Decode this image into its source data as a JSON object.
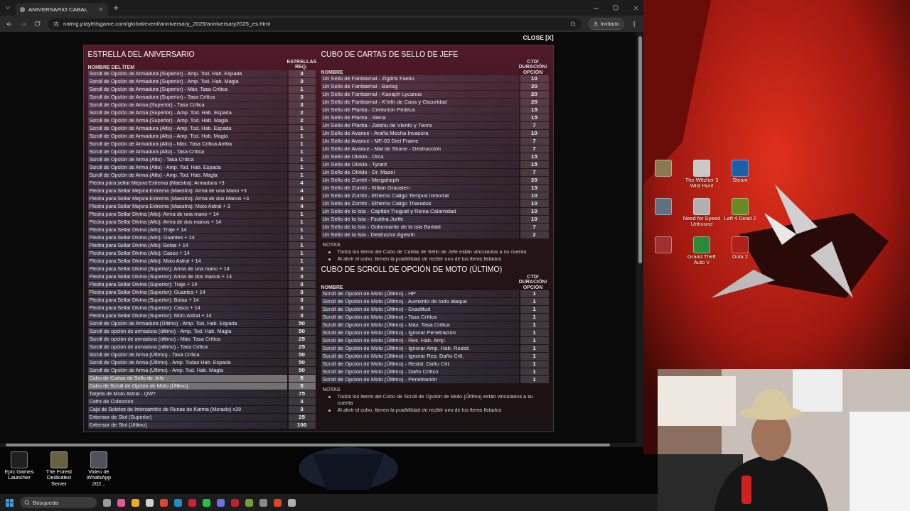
{
  "browser": {
    "tab_title": "ANIVERSARIO CABAL",
    "url": "naimg.playthisgame.com/global/event/anniversary_2025/anniversary2025_es.html",
    "profile": "Invitado"
  },
  "modal": {
    "close": "CLOSE [X]",
    "left": {
      "title": "ESTRELLA DEL ANIVERSARIO",
      "name_header": "NOMBRE DEL ÍTEM",
      "value_header": "ESTRELLAS REQ.",
      "rows": [
        {
          "name": "Scroll de Opción de Armadura (Superior) - Amp. Tod. Hab. Espada",
          "value": "3",
          "highlighted": false
        },
        {
          "name": "Scroll de Opción de Armadura (Superior) - Amp. Tod. Hab. Magia",
          "value": "3",
          "highlighted": false
        },
        {
          "name": "Scroll de Opción de Armadura (Superior) - Máx. Tasa Crítica",
          "value": "1",
          "highlighted": false
        },
        {
          "name": "Scroll de Opción de Armadura (Superior) - Tasa Crítica",
          "value": "3",
          "highlighted": false
        },
        {
          "name": "Scroll de Opción de Arma (Superior) - Tasa Crítica",
          "value": "3",
          "highlighted": false
        },
        {
          "name": "Scroll de Opción de Arma (Superior) - Amp. Tod. Hab. Espada",
          "value": "2",
          "highlighted": false
        },
        {
          "name": "Scroll de Opción de Arma (Superior) - Amp. Tod. Hab. Magia",
          "value": "2",
          "highlighted": false
        },
        {
          "name": "Scroll de Opción de Armadura (Alto) - Amp. Tod. Hab. Espada",
          "value": "1",
          "highlighted": false
        },
        {
          "name": "Scroll de Opción de Armadura (Alto) - Amp. Tod. Hab. Magia",
          "value": "1",
          "highlighted": false
        },
        {
          "name": "Scroll de Opción de Armadura (Alto) - Máx. Tasa Crítica Arriba",
          "value": "1",
          "highlighted": false
        },
        {
          "name": "Scroll de Opción de Armadura (Alto) - Tasa Crítica",
          "value": "1",
          "highlighted": false
        },
        {
          "name": "Scroll de Opción de Arma (Alto) - Tasa Crítica",
          "value": "1",
          "highlighted": false
        },
        {
          "name": "Scroll de Opción de Arma (Alto) - Amp. Tod. Hab. Espada",
          "value": "1",
          "highlighted": false
        },
        {
          "name": "Scroll de Opción de Arma (Alto) - Amp. Tod. Hab. Magia",
          "value": "1",
          "highlighted": false
        },
        {
          "name": "Piedra para sellar Mejora Extrema (Maestra): Armadura +3",
          "value": "4",
          "highlighted": false
        },
        {
          "name": "Piedra para Sellar Mejora Extrema (Maestra): Arma de una Mano +3",
          "value": "4",
          "highlighted": false
        },
        {
          "name": "Piedra para Sellar Mejora Extrema (Maestra): Arma de dos Manos +3",
          "value": "4",
          "highlighted": false
        },
        {
          "name": "Piedra para Sellar Mejora Extrema (Maestra): Moto Astral + 3",
          "value": "4",
          "highlighted": false
        },
        {
          "name": "Piedra para Sellar Divina (Alto): Arma de una mano + 14",
          "value": "1",
          "highlighted": false
        },
        {
          "name": "Piedra para Sellar Divina (Alto): Arma de dos manos + 14",
          "value": "1",
          "highlighted": false
        },
        {
          "name": "Piedra para Sellar Divina (Alto): Traje + 14",
          "value": "1",
          "highlighted": false
        },
        {
          "name": "Piedra para Sellar Divina (Alto): Guantes + 14",
          "value": "1",
          "highlighted": false
        },
        {
          "name": "Piedra para Sellar Divina (Alto): Botas + 14",
          "value": "1",
          "highlighted": false
        },
        {
          "name": "Piedra para Sellar Divina (Alto): Casco + 14",
          "value": "1",
          "highlighted": false
        },
        {
          "name": "Piedra para Sellar Divina (Alto): Moto Astral + 14",
          "value": "1",
          "highlighted": false
        },
        {
          "name": "Piedra para Sellar Divina (Superior): Arma de una mano + 14",
          "value": "3",
          "highlighted": false
        },
        {
          "name": "Piedra para Sellar Divina (Superior): Arma de dos manos + 14",
          "value": "3",
          "highlighted": false
        },
        {
          "name": "Piedra para Sellar Divina (Superior): Traje + 14",
          "value": "3",
          "highlighted": false
        },
        {
          "name": "Piedra para Sellar Divina (Superior): Guantes + 14",
          "value": "3",
          "highlighted": false
        },
        {
          "name": "Piedra para Sellar Divina (Superior): Botas + 14",
          "value": "3",
          "highlighted": false
        },
        {
          "name": "Piedra para Sellar Divina (Superior): Casco + 14",
          "value": "3",
          "highlighted": false
        },
        {
          "name": "Piedra para Sellar Divina (Superior): Moto Astral + 14",
          "value": "3",
          "highlighted": false
        },
        {
          "name": "Scroll de Opción de Armadura (Último) - Amp. Tod. Hab. Espada",
          "value": "50",
          "highlighted": false
        },
        {
          "name": "Scroll de opción de armadura (último) - Amp. Tod. Hab. Magia",
          "value": "50",
          "highlighted": false
        },
        {
          "name": "Scroll de opción de armadura (último) - Máx. Tasa Crítica",
          "value": "25",
          "highlighted": false
        },
        {
          "name": "Scroll de opción de armadura (último) - Tasa Crítica",
          "value": "25",
          "highlighted": false
        },
        {
          "name": "Scroll de Opción de Arma (Último) - Tasa Crítica",
          "value": "50",
          "highlighted": false
        },
        {
          "name": "Scroll de Opción de Arma (Último) - Amp. Todas Hab. Espada",
          "value": "50",
          "highlighted": false
        },
        {
          "name": "Scroll de Opción de Arma (Último) - Amp. Tod. Hab. Magia",
          "value": "50",
          "highlighted": false
        },
        {
          "name": "Cubo de Cartas de Sello de Jefe",
          "value": "5",
          "highlighted": true
        },
        {
          "name": "Cubo de Scroll de Opción de Moto (Último)",
          "value": "5",
          "highlighted": true
        },
        {
          "name": "Tarjeta de Moto Astral - QW7",
          "value": "75",
          "highlighted": false
        },
        {
          "name": "Cofre de Colección",
          "value": "3",
          "highlighted": false
        },
        {
          "name": "Caja de Boletos de intercambio de Runas de Karma (Morado) x20",
          "value": "3",
          "highlighted": false
        },
        {
          "name": "Extensor de Slot (Superior)",
          "value": "25",
          "highlighted": false
        },
        {
          "name": "Extensor de Slot (Último)",
          "value": "100",
          "highlighted": false
        }
      ]
    },
    "right": [
      {
        "title": "CUBO DE CARTAS DE SELLO DE JEFE",
        "name_header": "NOMBRE",
        "value_header": "CTD/DURACIÓN/OPCIÓN",
        "rows": [
          {
            "name": "Un Sello de Fantasmal - Zigdris Faello",
            "value": "10"
          },
          {
            "name": "Un Sello de Fantasmal - Barlog",
            "value": "20"
          },
          {
            "name": "Un Sello de Fantasmal - Kanaph Lycanus",
            "value": "20"
          },
          {
            "name": "Un Sello de Fantasmal - K'nith de Caos y Oscuridad",
            "value": "20"
          },
          {
            "name": "Un Sello de Planta - Centurion Prideus",
            "value": "15"
          },
          {
            "name": "Un Sello de Planta - Siena",
            "value": "15"
          },
          {
            "name": "Un Sello de Planta -  Zaishu de Viento y Tierra",
            "value": "7"
          },
          {
            "name": "Un Sello de Avance - Araña Mecha Invasora",
            "value": "10"
          },
          {
            "name": "Un Sello de Avance - MF-03 Drei Frame",
            "value": "7"
          },
          {
            "name": "Un Sello de Avance - Mal de Shane - Destrucción",
            "value": "7"
          },
          {
            "name": "Un Sello de Olvido - Orca",
            "value": "15"
          },
          {
            "name": "Un Sello de Olvido - Tyrant",
            "value": "15"
          },
          {
            "name": "Un Sello de Olvido - Dr. Mazel",
            "value": "7"
          },
          {
            "name": "Un Sello de Zombi - Mergaheph",
            "value": "20"
          },
          {
            "name": "Un Sello de Zombi - Killian Grausten",
            "value": "15"
          },
          {
            "name": "Un Sello de Zombi - Etherno Caligo Tempus Inmortal",
            "value": "10"
          },
          {
            "name": "Un Sello de Zombi - Etherno Caligo Thanatos",
            "value": "10"
          },
          {
            "name": "Un Sello de la Isla - Capitán Trugust y Reina Calamidad",
            "value": "10"
          },
          {
            "name": "Un Sello de la Isla - Fsobha Jurife",
            "value": "10"
          },
          {
            "name": "Un Sello de la Isla - Gobernante de la Isla Bariald",
            "value": "7"
          },
          {
            "name": "Un Sello de la Isla - Destructor Ageluth",
            "value": "2"
          }
        ],
        "notes_title": "NOTAS",
        "notes": [
          "Todos los items del Cubo de Cartas de Sello de Jefe están vinculados a su cuenta",
          "Al abrir el cubo, tienen la posibilidad de recibir uno de los items listados"
        ]
      },
      {
        "title": "CUBO DE SCROLL DE OPCIÓN DE MOTO (ÚLTIMO)",
        "name_header": "NOMBRE",
        "value_header": "CTD/DURACIÓN/OPCIÓN",
        "rows": [
          {
            "name": "Scroll de Opción de Moto (Último) - HP",
            "value": "1"
          },
          {
            "name": "Scroll de Opción de Moto (Último) - Aumento de todo ataque",
            "value": "1"
          },
          {
            "name": "Scroll de Opción de Moto (Último) - Exactitud",
            "value": "1"
          },
          {
            "name": "Scroll de Opción de Moto (Último) - Tasa Crítica",
            "value": "1"
          },
          {
            "name": "Scroll de Opción de Moto (Último) - Máx. Tasa Crítica",
            "value": "1"
          },
          {
            "name": "Scroll de Opción de Moto (Último) - Ignorar Penetración",
            "value": "1"
          },
          {
            "name": "Scroll de Opción de Moto (Último) - Res. Hab. Amp.",
            "value": "1"
          },
          {
            "name": "Scroll de Opción de Moto (Último) - Ignorar Amp. Hab. Resist.",
            "value": "1"
          },
          {
            "name": "Scroll de Opción de Moto (Último) - Ignorar Res. Daño Crit.",
            "value": "1"
          },
          {
            "name": "Scroll de Opción de Moto (Último) - Resist. Daño Crit.",
            "value": "1"
          },
          {
            "name": "Scroll de Opción de Moto (Último) - Daño Crítico",
            "value": "1"
          },
          {
            "name": "Scroll de Opción de Moto (Último) - Penetración",
            "value": "1"
          }
        ],
        "notes_title": "NOTAS",
        "notes": [
          "Todos los items del Cubo de Scroll de Opción de Moto (Último) están vinculados a su cuenta",
          "Al abrir el cubo, tienen la posibilidad de recibir uno de los items listados"
        ]
      }
    ]
  },
  "desktop": {
    "right_icons": [
      {
        "color": "#8a7a50"
      },
      {
        "label": "The Witcher 3 Wild Hunt",
        "color": "#c8c8c8"
      },
      {
        "label": "Steam",
        "color": "#1b5fa8"
      },
      {
        "color": "#607080"
      },
      {
        "label": "Need for Speed Unbound",
        "color": "#b0b0b0"
      },
      {
        "label": "Left 4 Dead 2",
        "color": "#6a8a20"
      },
      {
        "color": "#a03030"
      },
      {
        "label": "Grand Theft Auto V",
        "color": "#2a8a3a"
      },
      {
        "label": "Dota 2",
        "color": "#b02018"
      }
    ],
    "left_icons": [
      {
        "label": "Epic Games Launcher",
        "color": "#202020"
      },
      {
        "label": "The Forest Dedicated Server",
        "color": "#6a6040"
      },
      {
        "label": "Video de WhatsApp 202...",
        "color": "#505060"
      }
    ]
  },
  "taskbar": {
    "search": {
      "placeholder": "Búsqueda"
    },
    "apps": [
      {
        "color": "#9a9a9a"
      },
      {
        "color": "#e05a9a"
      },
      {
        "color": "#e8b020"
      },
      {
        "color": "#d0d0d0"
      },
      {
        "color": "#e0442a"
      },
      {
        "color": "#1e90c8"
      },
      {
        "color": "#d02030"
      },
      {
        "color": "#25c040"
      },
      {
        "color": "#6a70e8"
      },
      {
        "color": "#c02030"
      },
      {
        "color": "#70a030"
      },
      {
        "color": "#8a8a8a"
      },
      {
        "color": "#e0442a"
      },
      {
        "color": "#b0b0b0"
      }
    ]
  }
}
